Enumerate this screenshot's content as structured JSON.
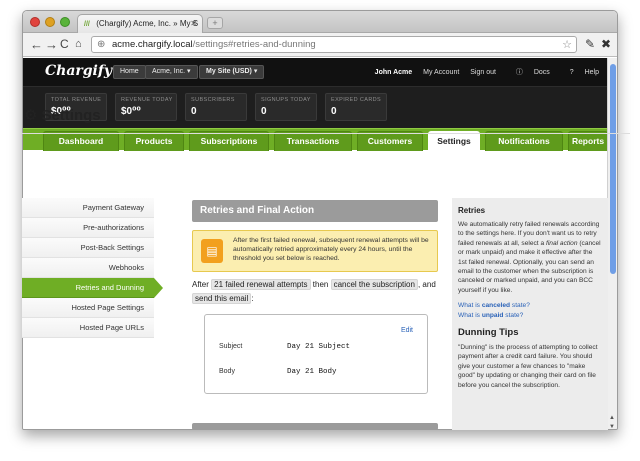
{
  "browser": {
    "tab_title": "(Chargify) Acme, Inc. » My S",
    "tab_favicon": "///",
    "url_host": "acme.chargify.local",
    "url_path": "/settings#retries-and-dunning"
  },
  "header": {
    "logo": "Chargify",
    "home": "Home",
    "account": "Acme, Inc. ▾",
    "site": "My Site (USD) ▾",
    "user_name": "John Acme",
    "my_account": "My Account",
    "sign_out": "Sign out",
    "docs": "Docs",
    "help": "Help"
  },
  "stats": [
    {
      "label": "TOTAL REVENUE",
      "value": "$0⁰⁰"
    },
    {
      "label": "REVENUE TODAY",
      "value": "$0⁰⁰"
    },
    {
      "label": "SUBSCRIBERS",
      "value": "0"
    },
    {
      "label": "SIGNUPS TODAY",
      "value": "0"
    },
    {
      "label": "EXPIRED CARDS",
      "value": "0"
    }
  ],
  "nav": {
    "dashboard": "Dashboard",
    "products": "Products",
    "subscriptions": "Subscriptions",
    "transactions": "Transactions",
    "customers": "Customers",
    "settings": "Settings",
    "notifications": "Notifications",
    "reports": "Reports"
  },
  "page": {
    "title": "Settings"
  },
  "sidemenu": {
    "payment_gateway": "Payment Gateway",
    "preauth": "Pre-authorizations",
    "postback": "Post-Back Settings",
    "webhooks": "Webhooks",
    "retries": "Retries and Dunning",
    "hosted_page_settings": "Hosted Page Settings",
    "hosted_page_urls": "Hosted Page URLs"
  },
  "main": {
    "section_title": "Retries and Final Action",
    "notice": "After the first failed renewal, subsequent renewal attempts will be automatically retried approximately every 24 hours, until the threshold you set below is reached.",
    "sentence_after": "After",
    "attempts": "21 failed renewal attempts",
    "then": "then",
    "action": "cancel the subscription",
    "and": ", and",
    "send_email": "send this email",
    "colon": ":",
    "edit": "Edit",
    "subject_label": "Subject",
    "subject_value": "Day 21 Subject",
    "body_label": "Body",
    "body_value": "Day 21 Body"
  },
  "sidebar": {
    "retries_title": "Retries",
    "retries_text_1": "We automatically retry failed renewals according to the settings here. If you don't want us to retry failed renewals at all, select a",
    "retries_text_em": "final action",
    "retries_text_2": "(cancel or mark unpaid) and make it effective after the 1st failed renewal. Optionally, you can send an email to the customer when the subscription is canceled or marked unpaid, and you can BCC yourself if you like.",
    "link_canceled_pre": "What is",
    "link_canceled_word": "canceled",
    "link_canceled_post": "state?",
    "link_unpaid_pre": "What is",
    "link_unpaid_word": "unpaid",
    "link_unpaid_post": "state?",
    "dunning_title": "Dunning Tips",
    "dunning_text": "\"Dunning\" is the process of attempting to collect payment after a credit card failure. You should give your customer a few chances to \"make good\" by updating or changing their card on file before you cancel the subscription."
  },
  "colors": {
    "brand_green": "#6fae25",
    "header_bg": "#111111",
    "notice_bg": "#fbeeb0",
    "link": "#2a62b8"
  }
}
